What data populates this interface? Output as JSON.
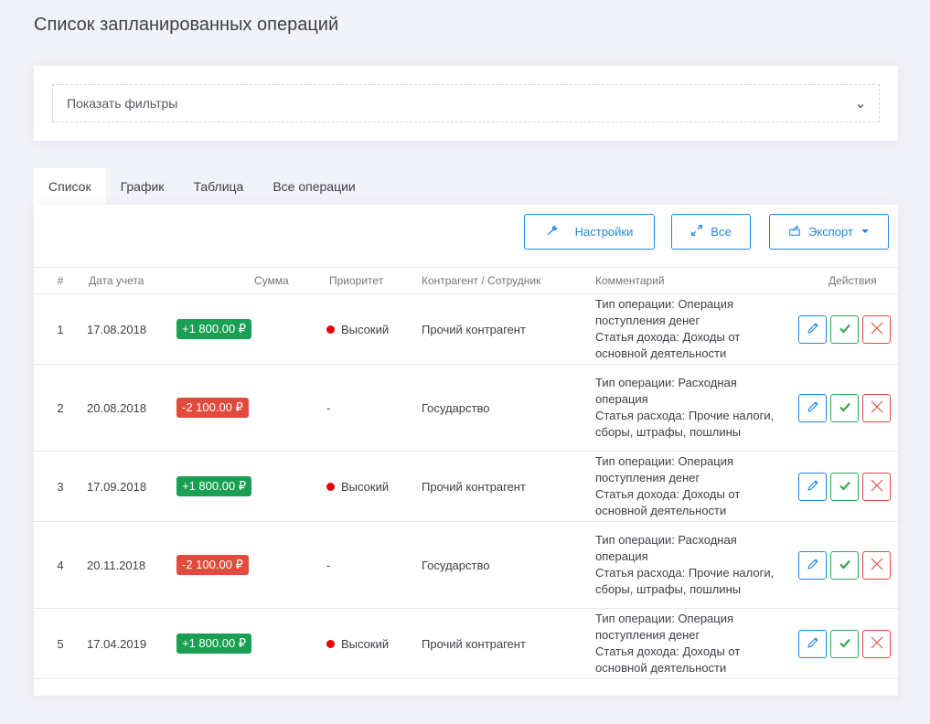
{
  "page": {
    "title": "Список запланированных операций"
  },
  "filters": {
    "toggle_label": "Показать фильтры"
  },
  "tabs": [
    {
      "label": "Список",
      "active": true
    },
    {
      "label": "График",
      "active": false
    },
    {
      "label": "Таблица",
      "active": false
    },
    {
      "label": "Все операции",
      "active": false
    }
  ],
  "toolbar": {
    "settings_label": "Настройки",
    "all_label": "Все",
    "export_label": "Экспорт"
  },
  "table": {
    "headers": [
      "#",
      "Дата учета",
      "Сумма",
      "Приоритет",
      "Контрагент / Сотрудник",
      "Комментарий",
      "Действия"
    ],
    "rows": [
      {
        "num": "1",
        "date": "17.08.2018",
        "amount": "+1 800.00 ₽",
        "amount_type": "positive",
        "priority": "Высокий",
        "counterparty": "Прочий контрагент",
        "comment": [
          "Тип операции: Операция поступления денег",
          "Статья дохода: Доходы от основной деятельности"
        ]
      },
      {
        "num": "2",
        "date": "20.08.2018",
        "amount": "-2 100.00 ₽",
        "amount_type": "negative",
        "priority": "-",
        "counterparty": "Государство",
        "comment": [
          "Тип операции: Расходная операция",
          "Статья расхода: Прочие налоги, сборы, штрафы, пошлины"
        ]
      },
      {
        "num": "3",
        "date": "17.09.2018",
        "amount": "+1 800.00 ₽",
        "amount_type": "positive",
        "priority": "Высокий",
        "counterparty": "Прочий контрагент",
        "comment": [
          "Тип операции: Операция поступления денег",
          "Статья дохода: Доходы от основной деятельности"
        ]
      },
      {
        "num": "4",
        "date": "20.11.2018",
        "amount": "-2 100.00 ₽",
        "amount_type": "negative",
        "priority": "-",
        "counterparty": "Государство",
        "comment": [
          "Тип операции: Расходная операция",
          "Статья расхода: Прочие налоги, сборы, штрафы, пошлины"
        ]
      },
      {
        "num": "5",
        "date": "17.04.2019",
        "amount": "+1 800.00 ₽",
        "amount_type": "positive",
        "priority": "Высокий",
        "counterparty": "Прочий контрагент",
        "comment": [
          "Тип операции: Операция поступления денег",
          "Статья дохода: Доходы от основной деятельности"
        ]
      }
    ]
  },
  "colors": {
    "accent": "#1e88e5",
    "positive": "#1aa053",
    "negative": "#e04b3d",
    "priority_high": "#e3000f"
  }
}
